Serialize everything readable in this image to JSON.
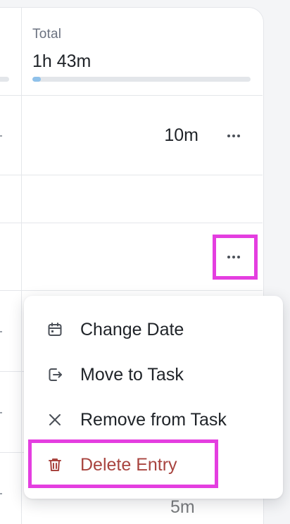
{
  "summary": {
    "total_label": "Total",
    "total_value": "1h 43m",
    "progress_fraction": 0.04
  },
  "rows": [
    {
      "duration": "10m"
    }
  ],
  "context_menu": {
    "items": [
      {
        "label": "Change Date",
        "icon": "calendar-icon"
      },
      {
        "label": "Move to Task",
        "icon": "move-out-icon"
      },
      {
        "label": "Remove from Task",
        "icon": "close-icon"
      },
      {
        "label": "Delete Entry",
        "icon": "trash-icon"
      }
    ]
  },
  "peek_text": "5m",
  "colors": {
    "highlight": "#e43ee0",
    "danger": "#a8443f",
    "progress": "#8fc1ea"
  }
}
